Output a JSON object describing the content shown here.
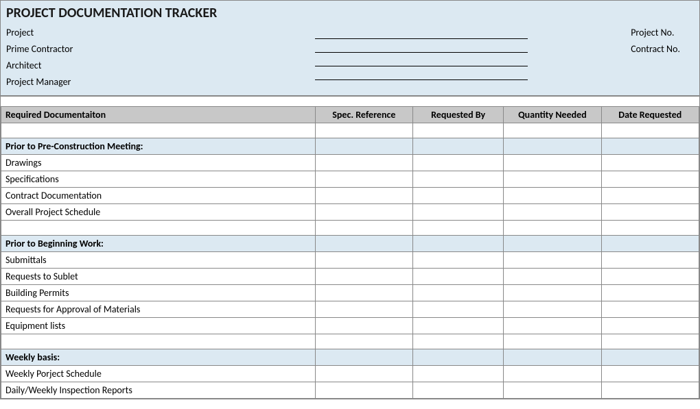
{
  "header": {
    "title": "PROJECT DOCUMENTATION TRACKER",
    "left_labels": [
      "Project",
      "Prime Contractor",
      "Architect",
      "Project Manager"
    ],
    "right_labels": [
      "Project No.",
      "Contract No."
    ]
  },
  "columns": {
    "doc": "Required Documentaiton",
    "spec": "Spec. Reference",
    "requested_by": "Requested By",
    "quantity": "Quantity Needed",
    "date": "Date Requested"
  },
  "sections": [
    {
      "heading": "Prior to Pre-Construction Meeting:",
      "items": [
        "Drawings",
        "Specifications",
        "Contract Documentation",
        "Overall Project Schedule"
      ]
    },
    {
      "heading": "Prior to Beginning Work:",
      "items": [
        "Submittals",
        "Requests to Sublet",
        "Building Permits",
        "Requests for Approval of Materials",
        "Equipment lists"
      ]
    },
    {
      "heading": "Weekly basis:",
      "items": [
        "Weekly Porject Schedule",
        "Daily/Weekly Inspection Reports"
      ]
    }
  ]
}
